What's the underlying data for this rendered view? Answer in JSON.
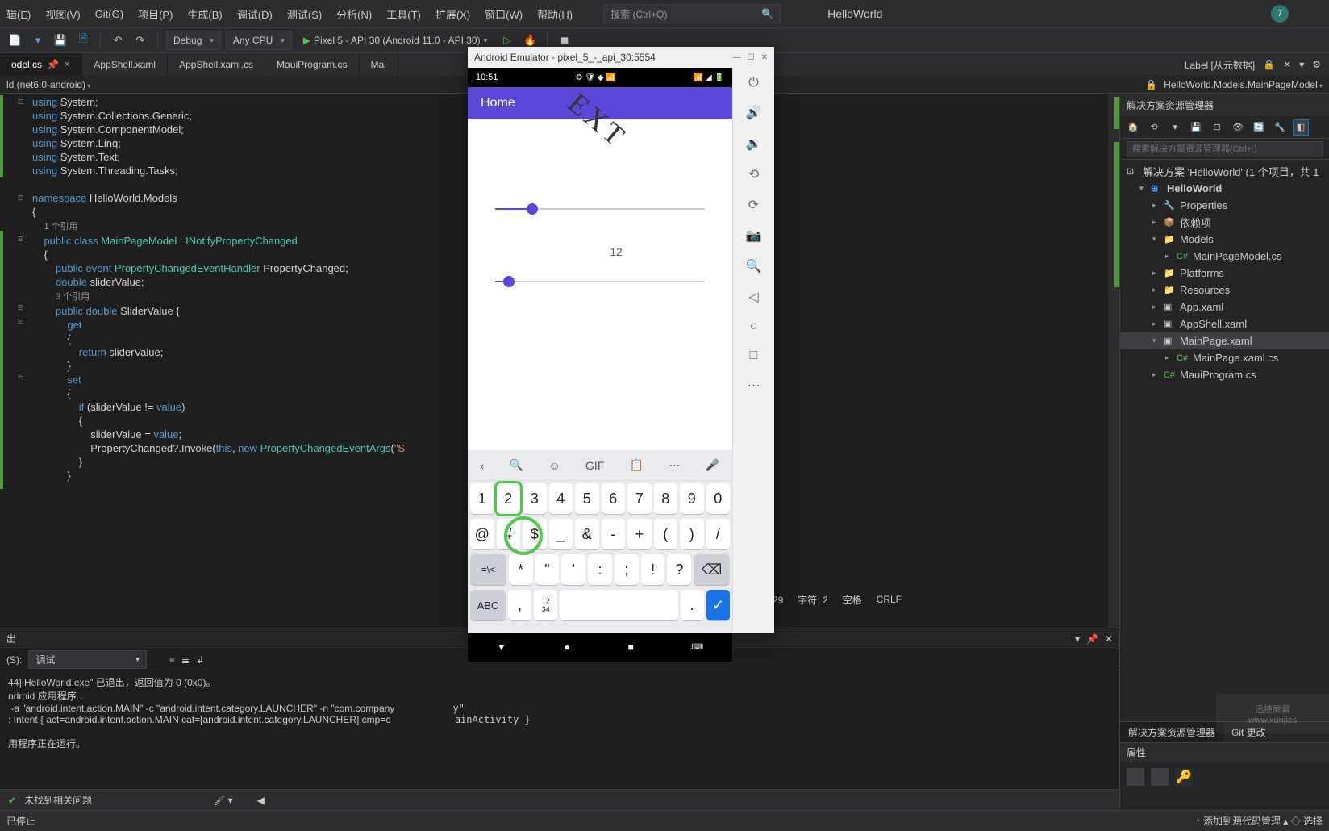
{
  "menubar": {
    "items": [
      "辑(E)",
      "视图(V)",
      "Git(G)",
      "项目(P)",
      "生成(B)",
      "调试(D)",
      "测试(S)",
      "分析(N)",
      "工具(T)",
      "扩展(X)",
      "窗口(W)",
      "帮助(H)"
    ],
    "search_placeholder": "搜索 (Ctrl+Q)",
    "app_title": "HelloWorld",
    "avatar_initial": "7"
  },
  "toolbar": {
    "config": "Debug",
    "platform": "Any CPU",
    "run_target": "Pixel 5 - API 30 (Android 11.0 - API 30)"
  },
  "tabs": [
    {
      "label": "odel.cs",
      "active": true
    },
    {
      "label": "AppShell.xaml",
      "active": false
    },
    {
      "label": "AppShell.xaml.cs",
      "active": false
    },
    {
      "label": "MauiProgram.cs",
      "active": false
    },
    {
      "label": "Mai",
      "active": false
    }
  ],
  "tab_right_badge": "Label [从元数据]",
  "breadcrumb": {
    "project": "ld (net6.0-android)",
    "path": "HelloWorld.Models.MainPageModel"
  },
  "code": {
    "ref1": "1 个引用",
    "ref2": "3 个引用"
  },
  "error_bar": {
    "msg": "未找到相关问题"
  },
  "status_code": {
    "line": "行: 29",
    "char": "字符: 2",
    "space": "空格",
    "crlf": "CRLF"
  },
  "output": {
    "title": "出",
    "source_label": "(S):",
    "source": "调试",
    "lines": [
      "44] HelloWorld.exe\" 已退出，返回值为 0 (0x0)。",
      "ndroid 应用程序...",
      " -a \"android.intent.action.MAIN\" -c \"android.intent.category.LAUNCHER\" -n \"com.company",
      ": Intent { act=android.intent.action.MAIN cat=[android.intent.category.LAUNCHER] cmp=c",
      "",
      "用程序正在运行。"
    ]
  },
  "statusbar2": {
    "left": "已停止",
    "right": "↑ 添加到源代码管理 ▴    ◇ 选择"
  },
  "sidebar": {
    "title": "解决方案资源管理器",
    "search_placeholder": "搜索解决方案资源管理器(Ctrl+;)",
    "solution": "解决方案 'HelloWorld' (1 个项目，共 1",
    "tree": {
      "root": "HelloWorld",
      "items": [
        "Properties",
        "依赖项",
        "Models",
        "MainPageModel.cs",
        "Platforms",
        "Resources",
        "App.xaml",
        "AppShell.xaml",
        "MainPage.xaml",
        "MainPage.xaml.cs",
        "MauiProgram.cs"
      ]
    },
    "tabs": [
      "解决方案资源管理器",
      "Git 更改"
    ],
    "props_title": "属性"
  },
  "emulator": {
    "title": "Android Emulator - pixel_5_-_api_30:5554",
    "time": "10:51",
    "app_title": "Home",
    "rotated_text": "EXT",
    "value": "12",
    "slider1_pct": 15,
    "slider2_pct": 4,
    "kb_gif": "GIF",
    "row1": [
      "1",
      "2",
      "3",
      "4",
      "5",
      "6",
      "7",
      "8",
      "9",
      "0"
    ],
    "row2": [
      "@",
      "#",
      "$",
      "_",
      "&",
      "-",
      "+",
      "(",
      ")",
      "/"
    ],
    "row3": [
      "=\\<",
      "*",
      "\"",
      "'",
      ":",
      ";",
      "!",
      "?",
      "⌫"
    ],
    "row4_abc": "ABC",
    "row4_comma": ",",
    "row4_num": "12\n34",
    "row4_dot": ".",
    "row4_enter": "✓"
  },
  "watermark": {
    "l1": "迅捷屏幕",
    "l2": "www.xunjies"
  }
}
